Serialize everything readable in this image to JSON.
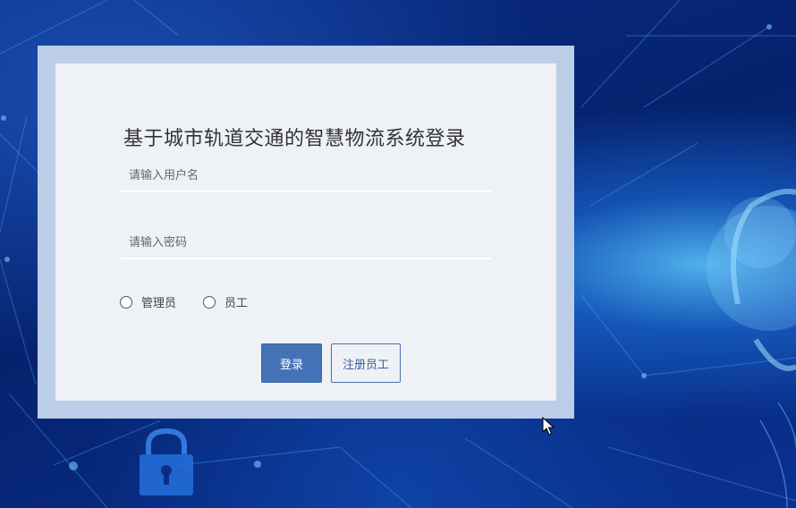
{
  "login": {
    "title": "基于城市轨道交通的智慧物流系统登录",
    "username_placeholder": "请输入用户名",
    "password_placeholder": "请输入密码",
    "roles": [
      {
        "label": "管理员",
        "selected": false
      },
      {
        "label": "员工",
        "selected": false
      }
    ],
    "login_button": "登录",
    "register_button": "注册员工"
  },
  "colors": {
    "background": "#06226e",
    "panel_border": "#bccde8",
    "panel": "#eef1f6",
    "primary": "#4472b7"
  },
  "icons": [
    "padlock-icon",
    "mouse-cursor-icon"
  ]
}
